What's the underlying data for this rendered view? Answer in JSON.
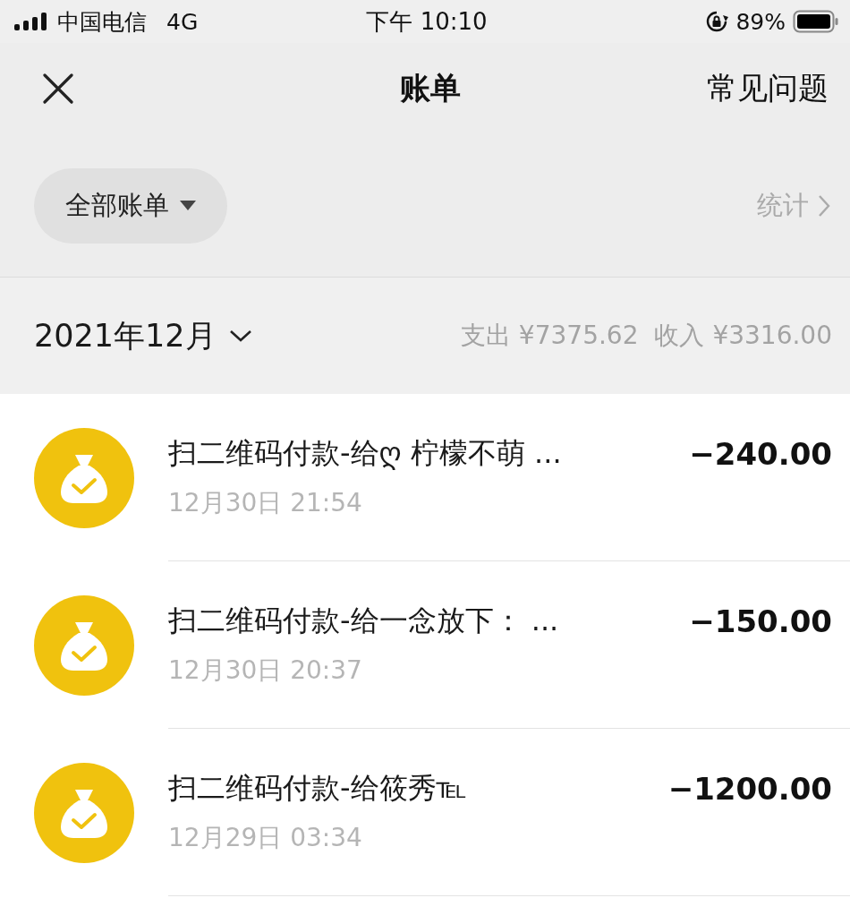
{
  "status_bar": {
    "carrier": "中国电信",
    "network": "4G",
    "time": "下午 10:10",
    "battery": "89%"
  },
  "header": {
    "title": "账单",
    "action": "常见问题"
  },
  "filter": {
    "label": "全部账单",
    "stats": "统计"
  },
  "month": {
    "label": "2021年12月",
    "expense": "支出 ¥7375.62",
    "income": "收入 ¥3316.00"
  },
  "transactions": [
    {
      "title": "扫二维码付款-给ღ 柠檬不萌 ...",
      "time": "12月30日 21:54",
      "amount": "−240.00"
    },
    {
      "title": "扫二维码付款-给一念放下： ...",
      "time": "12月30日 20:37",
      "amount": "−150.00"
    },
    {
      "title": "扫二维码付款-给筱秀℡",
      "time": "12月29日 03:34",
      "amount": "−1200.00"
    }
  ]
}
